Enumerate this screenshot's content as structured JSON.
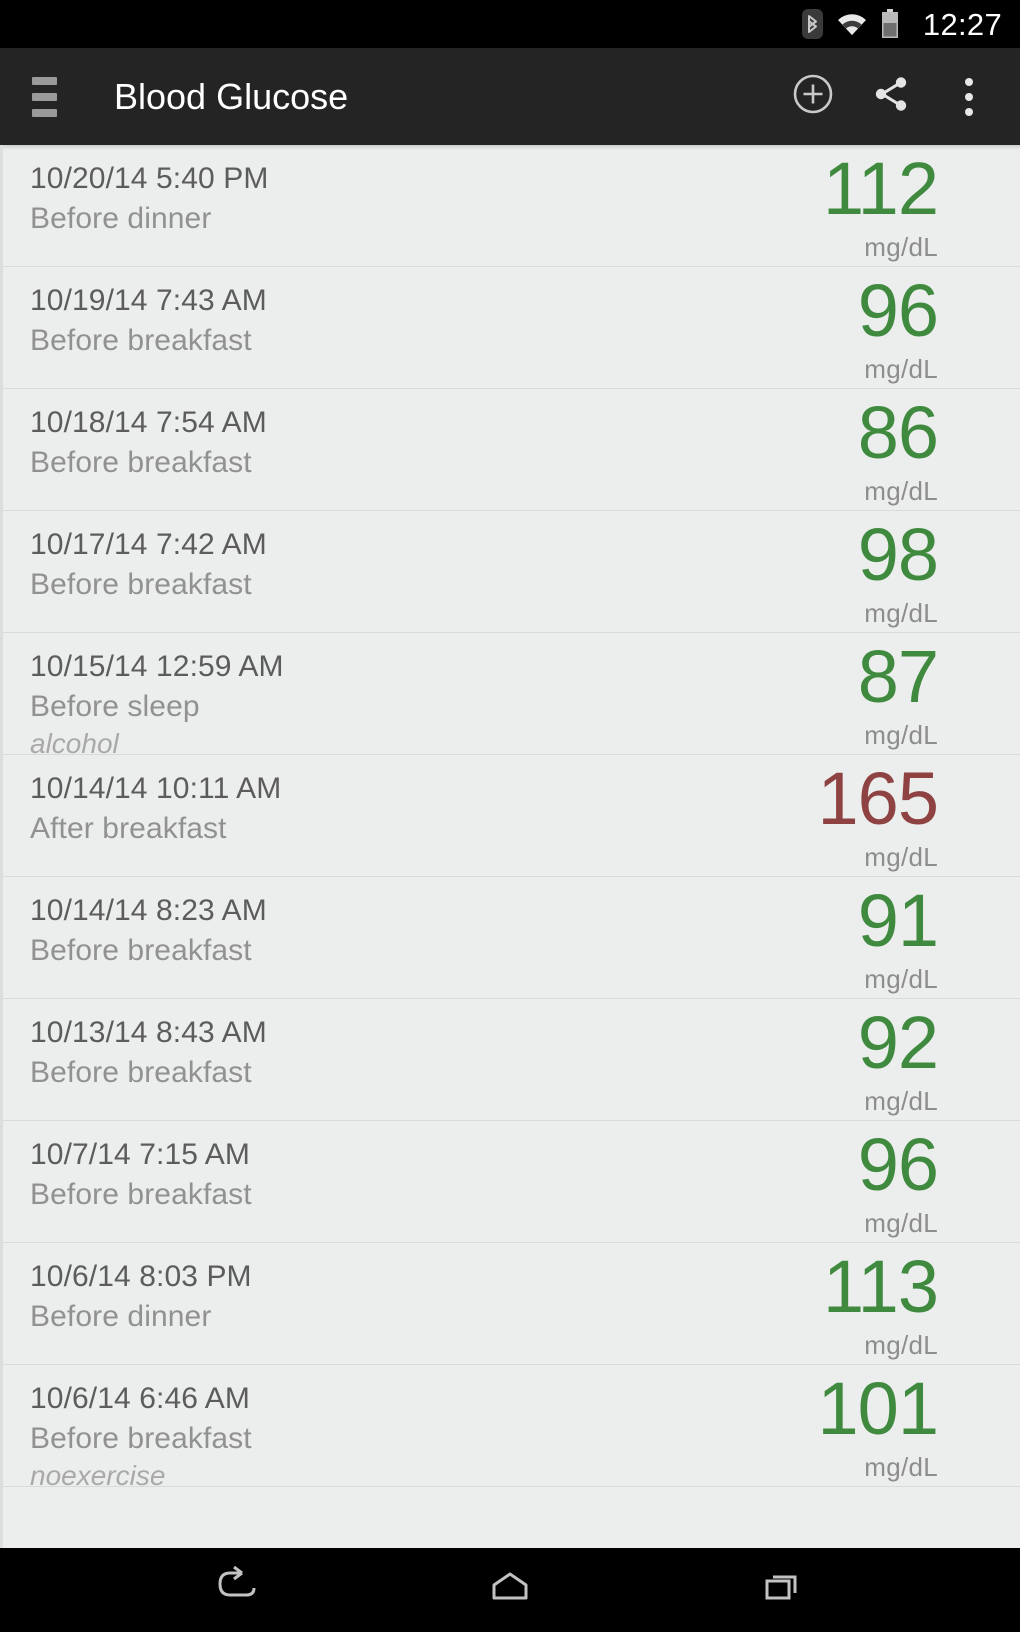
{
  "status_bar": {
    "clock": "12:27",
    "icons": [
      "bluetooth-icon",
      "wifi-icon",
      "battery-icon"
    ]
  },
  "action_bar": {
    "menu_icon": "hamburger-menu-icon",
    "title": "Blood Glucose",
    "actions": [
      {
        "name": "add-button",
        "icon": "plus-circle-icon"
      },
      {
        "name": "share-button",
        "icon": "share-icon"
      },
      {
        "name": "overflow-button",
        "icon": "more-vertical-icon"
      }
    ]
  },
  "colors": {
    "normal": "#3f8a3f",
    "high": "#8e4242",
    "action_bar_bg": "#242424",
    "list_bg": "#eceeed",
    "divider": "#d9dbda"
  },
  "list": {
    "unit": "mg/dL",
    "entries": [
      {
        "datetime": "10/20/14 5:40 PM",
        "meal": "Before dinner",
        "note": "",
        "value": "112",
        "unit": "mg/dL",
        "status": "normal"
      },
      {
        "datetime": "10/19/14 7:43 AM",
        "meal": "Before breakfast",
        "note": "",
        "value": "96",
        "unit": "mg/dL",
        "status": "normal"
      },
      {
        "datetime": "10/18/14 7:54 AM",
        "meal": "Before breakfast",
        "note": "",
        "value": "86",
        "unit": "mg/dL",
        "status": "normal"
      },
      {
        "datetime": "10/17/14 7:42 AM",
        "meal": "Before breakfast",
        "note": "",
        "value": "98",
        "unit": "mg/dL",
        "status": "normal"
      },
      {
        "datetime": "10/15/14 12:59 AM",
        "meal": "Before sleep",
        "note": "alcohol",
        "value": "87",
        "unit": "mg/dL",
        "status": "normal"
      },
      {
        "datetime": "10/14/14 10:11 AM",
        "meal": "After breakfast",
        "note": "",
        "value": "165",
        "unit": "mg/dL",
        "status": "high"
      },
      {
        "datetime": "10/14/14 8:23 AM",
        "meal": "Before breakfast",
        "note": "",
        "value": "91",
        "unit": "mg/dL",
        "status": "normal"
      },
      {
        "datetime": "10/13/14 8:43 AM",
        "meal": "Before breakfast",
        "note": "",
        "value": "92",
        "unit": "mg/dL",
        "status": "normal"
      },
      {
        "datetime": "10/7/14 7:15 AM",
        "meal": "Before breakfast",
        "note": "",
        "value": "96",
        "unit": "mg/dL",
        "status": "normal"
      },
      {
        "datetime": "10/6/14 8:03 PM",
        "meal": "Before dinner",
        "note": "",
        "value": "113",
        "unit": "mg/dL",
        "status": "normal"
      },
      {
        "datetime": "10/6/14 6:46 AM",
        "meal": "Before breakfast",
        "note": "noexercise",
        "value": "101",
        "unit": "mg/dL",
        "status": "normal"
      }
    ]
  },
  "nav_bar": {
    "buttons": [
      {
        "name": "back-button",
        "icon": "back-arrow-icon"
      },
      {
        "name": "home-button",
        "icon": "home-icon"
      },
      {
        "name": "recents-button",
        "icon": "recents-icon"
      }
    ]
  }
}
